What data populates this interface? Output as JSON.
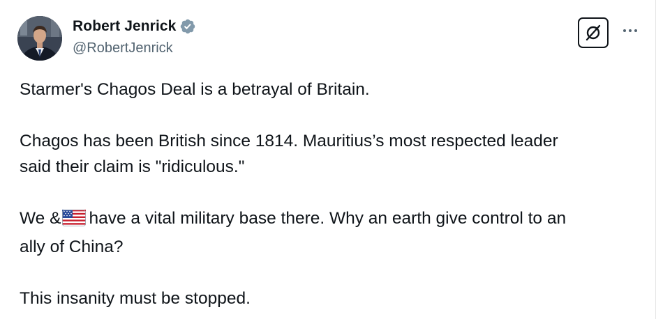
{
  "author": {
    "display_name": "Robert Jenrick",
    "handle": "@RobertJenrick",
    "verified": true,
    "verified_color": "#829aab"
  },
  "actions": {
    "grok_icon": "grok-slash-circle-icon",
    "more_icon": "more-dots-icon"
  },
  "tweet": {
    "line1": "Starmer's Chagos Deal is a betrayal of Britain.",
    "line2a": "Chagos has been British since 1814. Mauritius’s most respected leader",
    "line2b": "said their claim is \"ridiculous.\"",
    "line3_before_flag": "We &",
    "flag_icon": "us-flag-emoji",
    "line3_after_flag": "have a vital military base there. Why an earth give control to an",
    "line3b": "ally of China?",
    "line4": "This insanity must be stopped."
  },
  "colors": {
    "text": "#0f1419",
    "secondary": "#536471"
  }
}
